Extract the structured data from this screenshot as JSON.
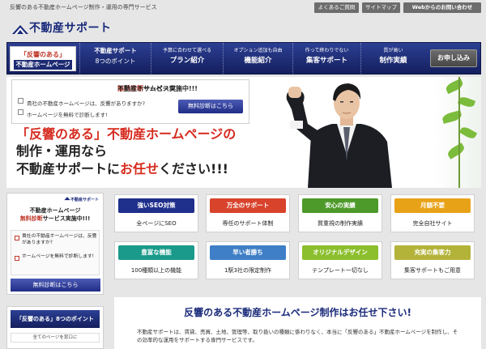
{
  "header": {
    "tagline": "反響のある不動産ホームページ制作・運用の専門サービス",
    "links": [
      "よくあるご質問",
      "サイトマップ",
      "Webからのお問い合わせ"
    ]
  },
  "logo": {
    "text": "不動産サポート"
  },
  "nav": {
    "first": {
      "line1": "「反響のある」",
      "line2": "不動産ホームページ"
    },
    "items": [
      {
        "sub": "不動産サポート",
        "main": "8つのポイント"
      },
      {
        "sub": "予算に合わせて選べる",
        "main": "プラン紹介"
      },
      {
        "sub": "オプション追加も自由",
        "main": "機能紹介"
      },
      {
        "sub": "作って終わりでない",
        "main": "集客サポート"
      },
      {
        "sub": "質が高い",
        "main": "制作実績"
      }
    ],
    "apply": "お申し込み"
  },
  "promo": {
    "title_prefix": "不動産ホームページ",
    "title_highlight": "無料診断",
    "title_suffix": "サービス実施中!!!",
    "checks": [
      "貴社の不動産ホームページは、反響がありますか?",
      "ホームページを無料で診断します!"
    ],
    "button": "無料診断はこちら"
  },
  "hero": {
    "line1": "「反響のある」不動産ホームページの",
    "line2": "制作・運用なら",
    "line3_prefix": "不動産サポートに",
    "line3_highlight": "お任せ",
    "line3_suffix": "ください!!!"
  },
  "sidebar": {
    "brand": "不動産サポート",
    "title1": "不動産ホームページ",
    "title2_highlight": "無料診断",
    "title2_suffix": "サービス実施中!!!",
    "checks": [
      "貴社の不動産ホームページは、反響がありますか?",
      "ホームページを無料で診断します!"
    ],
    "button": "無料診断はこちら",
    "points_title": "「反響のある」8つのポイント",
    "points_sub": "全てのページを窓口に"
  },
  "features": [
    {
      "label": "強いSEO対策",
      "desc": "全ページにSEO",
      "color": "#1f2f8c"
    },
    {
      "label": "万全のサポート",
      "desc": "専任のサポート体制",
      "color": "#d8432c"
    },
    {
      "label": "安心の実績",
      "desc": "質重視の制作実績",
      "color": "#4d9a2a"
    },
    {
      "label": "月額不要",
      "desc": "完全自社サイト",
      "color": "#e8a218"
    },
    {
      "label": "豊富な機能",
      "desc": "100種類以上の機能",
      "color": "#1a9a8a"
    },
    {
      "label": "早い者勝ち",
      "desc": "1駅3社の限定制作",
      "color": "#3f7fc7"
    },
    {
      "label": "オリジナルデザイン",
      "desc": "テンプレート一切なし",
      "color": "#8cbf2d"
    },
    {
      "label": "充実の集客力",
      "desc": "集客サポートもご用意",
      "color": "#b3b33a"
    }
  ],
  "main": {
    "title": "反響のある不動産ホームページ制作はお任せ下さい!",
    "text": "不動産サポートは、賃貸、売買、土地、管理等、取り扱いの種類に係わりなく、本当に「反響のある」不動産ホームページを制作し、その効率的な運用をサポートする専門サービスです。"
  }
}
